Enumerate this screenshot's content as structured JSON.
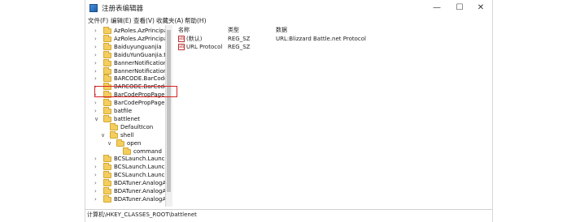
{
  "window": {
    "title": "注册表编辑器",
    "minimize_glyph": "—",
    "maximize_glyph": "☐",
    "close_glyph": "✕"
  },
  "menu": [
    "文件(F)",
    "编辑(E)",
    "查看(V)",
    "收藏夹(A)",
    "帮助(H)"
  ],
  "tree": {
    "items": [
      {
        "label": "AzRoles.AzPrincipalI",
        "expander": "›"
      },
      {
        "label": "AzRoles.AzPrincipalI",
        "expander": "›"
      },
      {
        "label": "Baiduyunguanjia",
        "expander": "›"
      },
      {
        "label": "BaiduYunGuanjia.tor",
        "expander": "›"
      },
      {
        "label": "BannerNotificationH",
        "expander": "›"
      },
      {
        "label": "BannerNotificationH",
        "expander": "›"
      },
      {
        "label": "BARCODE.BarCodeC",
        "expander": "›"
      },
      {
        "label": "BARCODE.BarCodeC",
        "expander": "›"
      },
      {
        "label": "BarCodePropPage.B",
        "expander": "›"
      },
      {
        "label": "BarCodePropPage.B",
        "expander": "›"
      },
      {
        "label": "batfile",
        "expander": "›"
      },
      {
        "label": "battlenet",
        "expander": "∨",
        "selected": true
      },
      {
        "label": "DefaultIcon",
        "expander": ""
      },
      {
        "label": "shell",
        "expander": "∨"
      },
      {
        "label": "open",
        "expander": "∨"
      },
      {
        "label": "command",
        "expander": ""
      },
      {
        "label": "BCSLaunch.Launche",
        "expander": "›"
      },
      {
        "label": "BCSLaunch.Launche",
        "expander": "›"
      },
      {
        "label": "BCSLaunch.Launche",
        "expander": "›"
      },
      {
        "label": "BDATuner.AnalogAu",
        "expander": "›"
      },
      {
        "label": "BDATuner.AnalogAu",
        "expander": "›"
      },
      {
        "label": "BDATuner.AnalogAu",
        "expander": "›"
      }
    ]
  },
  "values_list": {
    "columns": [
      "名称",
      "类型",
      "数据"
    ],
    "rows": [
      {
        "name": "(默认)",
        "type": "REG_SZ",
        "data": "URL:Blizzard Battle.net Protocol",
        "icon": "ab"
      },
      {
        "name": "URL Protocol",
        "type": "REG_SZ",
        "data": "",
        "icon": "ab"
      }
    ]
  },
  "status_bar": {
    "path": "计算机\\HKEY_CLASSES_ROOT\\battlenet"
  },
  "colors": {
    "selection_box": "#d9231f",
    "folder": "#f4cd5f"
  }
}
